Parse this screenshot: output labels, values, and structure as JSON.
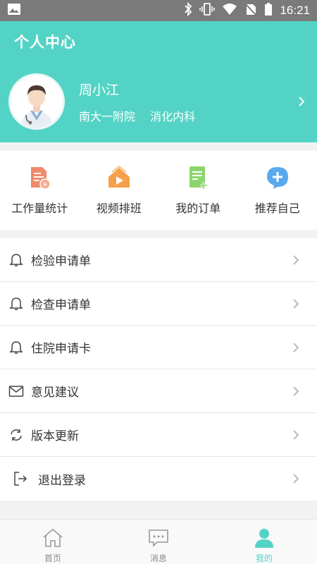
{
  "status_bar": {
    "time": "16:21",
    "icons": [
      "image-icon",
      "bluetooth-icon",
      "vibrate-icon",
      "wifi-icon",
      "no-sim-icon",
      "battery-icon"
    ]
  },
  "header": {
    "title": "个人中心",
    "bg_color": "#53d3c5"
  },
  "profile": {
    "name": "周小江",
    "hospital": "南大一附院",
    "department": "消化内科"
  },
  "quick_actions": [
    {
      "label": "工作量统计",
      "icon": "workload-stats-icon",
      "color": "#f08a6a"
    },
    {
      "label": "视频排班",
      "icon": "video-schedule-icon",
      "color": "#f5a04a"
    },
    {
      "label": "我的订单",
      "icon": "orders-icon",
      "color": "#8bd66c"
    },
    {
      "label": "推荐自己",
      "icon": "recommend-icon",
      "color": "#5aa9ef"
    }
  ],
  "menu": [
    {
      "label": "检验申请单",
      "icon": "bell-icon"
    },
    {
      "label": "检查申请单",
      "icon": "bell-icon"
    },
    {
      "label": "住院申请卡",
      "icon": "bell-icon"
    },
    {
      "label": "意见建议",
      "icon": "mail-icon"
    },
    {
      "label": "版本更新",
      "icon": "refresh-icon"
    },
    {
      "label": "退出登录",
      "icon": "logout-icon"
    }
  ],
  "tabs": [
    {
      "label": "首页",
      "icon": "home-icon",
      "active": false
    },
    {
      "label": "消息",
      "icon": "message-icon",
      "active": false
    },
    {
      "label": "我的",
      "icon": "user-icon",
      "active": true
    }
  ]
}
